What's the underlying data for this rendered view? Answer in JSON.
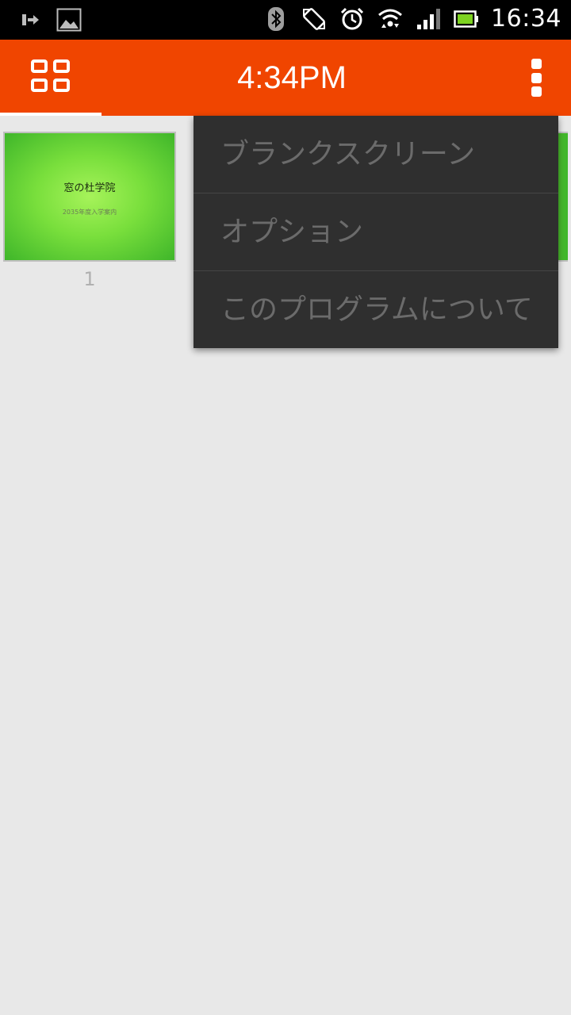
{
  "status_bar": {
    "time": "16:34",
    "icons_left": [
      "signin-icon",
      "image-icon"
    ],
    "icons_right": [
      "bluetooth-icon",
      "rotate-icon",
      "alarm-icon",
      "wifi-icon",
      "signal-icon",
      "battery-icon"
    ]
  },
  "app_bar": {
    "title": "4:34PM",
    "accent_color": "#f04500"
  },
  "slides": [
    {
      "number": "1",
      "title": "窓の杜学院",
      "subtitle": "2035年度入学案内"
    }
  ],
  "overflow_menu": {
    "items": [
      {
        "label": "ブランクスクリーン"
      },
      {
        "label": "オプション"
      },
      {
        "label": "このプログラムについて"
      }
    ]
  }
}
